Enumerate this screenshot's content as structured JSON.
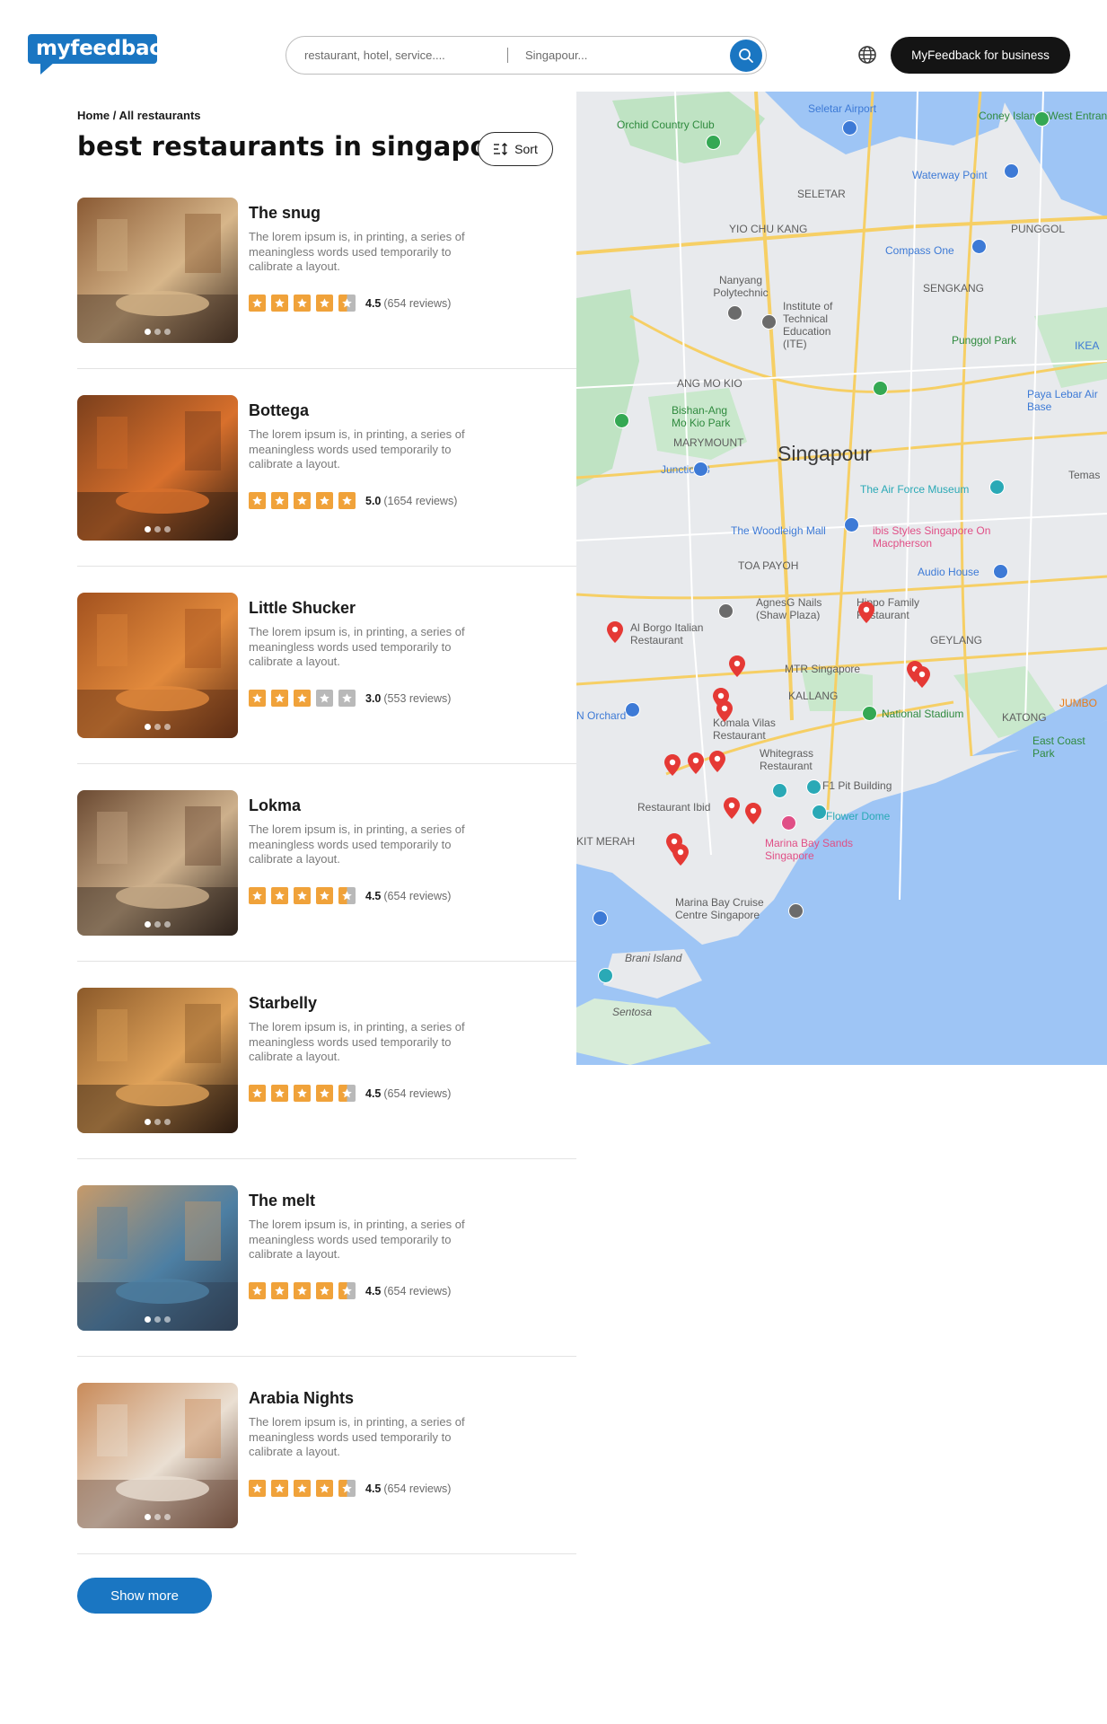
{
  "header": {
    "logo_text": "myfeedback",
    "search_what_placeholder": "restaurant, hotel, service....",
    "search_where_placeholder": "Singapour...",
    "business_button": "MyFeedback for business"
  },
  "breadcrumb": "Home / All restaurants",
  "page_title": "best restaurants in singapore",
  "sort_label": "Sort",
  "colors": {
    "brand_blue": "#1a76c2",
    "star_orange": "#f0a23a",
    "star_grey": "#b9b9b9",
    "map_pin_red": "#e53935"
  },
  "restaurants": [
    {
      "name": "The snug",
      "description": "The lorem ipsum is, in printing, a series of meaningless words used temporarily to calibrate a layout.",
      "rating": "4.5",
      "rating_value": 4.5,
      "reviews": "(654 reviews)",
      "photo_colors": [
        "#8a5a34",
        "#d7b68a",
        "#3b2a1e"
      ]
    },
    {
      "name": "Bottega",
      "description": "The lorem ipsum is, in printing, a series of meaningless words used temporarily to calibrate a layout.",
      "rating": "5.0",
      "rating_value": 5.0,
      "reviews": "(1654 reviews)",
      "photo_colors": [
        "#7b3f1c",
        "#d8702c",
        "#2e1c12"
      ]
    },
    {
      "name": "Little Shucker",
      "description": "The lorem ipsum is, in printing, a series of meaningless words used temporarily to calibrate a layout.",
      "rating": "3.0",
      "rating_value": 3.0,
      "reviews": "(553 reviews)",
      "photo_colors": [
        "#a3521f",
        "#e28a3c",
        "#5c2c14"
      ]
    },
    {
      "name": "Lokma",
      "description": "The lorem ipsum is, in printing, a series of meaningless words used temporarily to calibrate a layout.",
      "rating": "4.5",
      "rating_value": 4.5,
      "reviews": "(654 reviews)",
      "photo_colors": [
        "#6b4a32",
        "#cdb08c",
        "#2c211a"
      ]
    },
    {
      "name": "Starbelly",
      "description": "The lorem ipsum is, in printing, a series of meaningless words used temporarily to calibrate a layout.",
      "rating": "4.5",
      "rating_value": 4.5,
      "reviews": "(654 reviews)",
      "photo_colors": [
        "#8c5a2a",
        "#e0a35a",
        "#2b1a10"
      ]
    },
    {
      "name": "The melt",
      "description": "The lorem ipsum is, in printing, a series of meaningless words used temporarily to calibrate a layout.",
      "rating": "4.5",
      "rating_value": 4.5,
      "reviews": "(654 reviews)",
      "photo_colors": [
        "#c69a6a",
        "#4d7fa3",
        "#2e3e52"
      ]
    },
    {
      "name": "Arabia Nights",
      "description": "The lorem ipsum is, in printing, a series of meaningless words used temporarily to calibrate a layout.",
      "rating": "4.5",
      "rating_value": 4.5,
      "reviews": "(654 reviews)",
      "photo_colors": [
        "#c98b5a",
        "#eadfd2",
        "#6a4a3a"
      ]
    }
  ],
  "show_more": "Show more",
  "map": {
    "city": "Singapour",
    "labels": [
      "Seletar Airport",
      "Orchid Country Club",
      "Coney Island (West Entrance)",
      "Waterway Point",
      "SELETAR",
      "YIO CHU KANG",
      "PUNGGOL",
      "Compass One",
      "SENGKANG",
      "Nanyang Polytechnic",
      "Institute of Technical Education (ITE)",
      "Punggol Park",
      "ANG MO KIO",
      "Bishan-Ang Mo Kio Park",
      "MARYMOUNT",
      "Paya Lebar Air Base",
      "Junction 8",
      "The Air Force Museum",
      "The Woodleigh Mall",
      "ibis Styles Singapore On Macpherson",
      "Audio House",
      "TOA PAYOH",
      "AgnesG Nails (Shaw Plaza)",
      "Hippo Family Restaurant",
      "Al Borgo Italian Restaurant",
      "GEYLANG",
      "MTR Singapore",
      "KALLANG",
      "National Stadium",
      "KATONG",
      "Komala Vilas Restaurant",
      "Whitegrass Restaurant",
      "East Coast Park",
      "F1 Pit Building",
      "Restaurant Ibid",
      "Flower Dome",
      "KIT MERAH",
      "Marina Bay Sands Singapore",
      "Marina Bay Cruise Centre Singapore",
      "Brani Island",
      "Sentosa",
      "IKEA",
      "Temas",
      "N Orchard",
      "JUMBO"
    ]
  }
}
